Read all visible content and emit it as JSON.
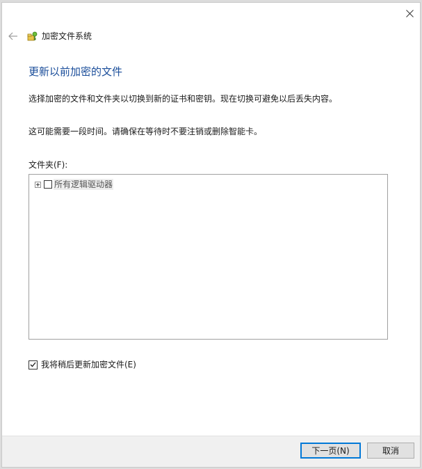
{
  "window": {
    "title": "加密文件系统"
  },
  "page": {
    "heading": "更新以前加密的文件",
    "description_1": "选择加密的文件和文件夹以切换到新的证书和密钥。现在切换可避免以后丢失内容。",
    "description_2": "这可能需要一段时间。请确保在等待时不要注销或删除智能卡。",
    "folders_label": "文件夹(F):",
    "tree": {
      "items": [
        {
          "label": "所有逻辑驱动器",
          "checked": false,
          "expanded": false
        }
      ]
    },
    "update_later": {
      "label": "我将稍后更新加密文件(E)",
      "checked": true
    }
  },
  "footer": {
    "next_label": "下一页(N)",
    "cancel_label": "取消"
  },
  "icons": {
    "close": "close-icon",
    "back": "back-arrow-icon",
    "app": "efs-key-icon",
    "check": "checkmark-icon"
  },
  "colors": {
    "heading": "#1a4d9a",
    "accent": "#0078d7"
  }
}
